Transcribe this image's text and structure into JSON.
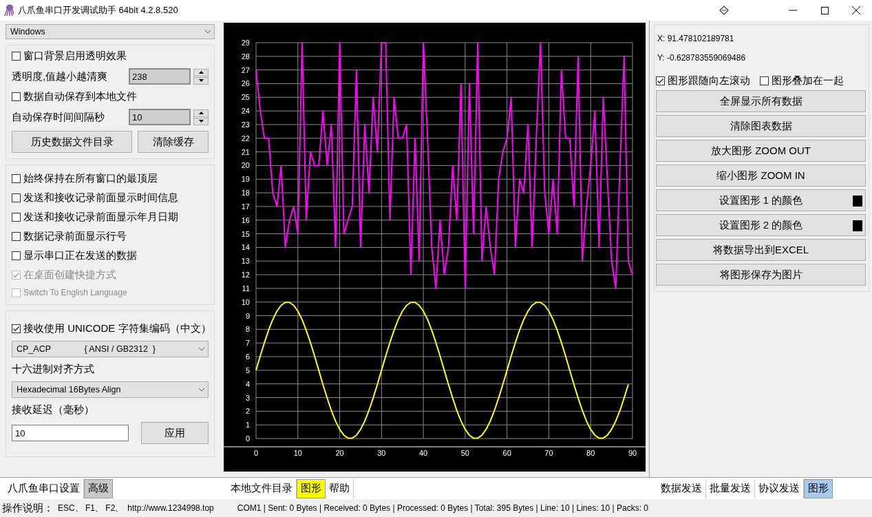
{
  "window": {
    "title": "八爪鱼串口开发调试助手 64bit 4.2.8.520"
  },
  "left_panel": {
    "skin_select": {
      "value": "Windows"
    },
    "group1": {
      "transparent_bg": {
        "label": "窗口背景启用透明效果",
        "checked": false
      },
      "opacity": {
        "label": "透明度,值越小越清爽",
        "value": "238"
      },
      "autosave": {
        "label": "数据自动保存到本地文件",
        "checked": false
      },
      "interval": {
        "label": "自动保存时间间隔秒",
        "value": "10"
      },
      "buttons": [
        "历史数据文件目录",
        "清除缓存"
      ]
    },
    "group2": {
      "options": [
        {
          "label": "始终保持在所有窗口的最顶层",
          "checked": false,
          "disabled": false
        },
        {
          "label": "发送和接收记录前面显示时间信息",
          "checked": false,
          "disabled": false
        },
        {
          "label": "发送和接收记录前面显示年月日期",
          "checked": false,
          "disabled": false
        },
        {
          "label": "数据记录前面显示行号",
          "checked": false,
          "disabled": false
        },
        {
          "label": "显示串口正在发送的数据",
          "checked": false,
          "disabled": false
        },
        {
          "label": "在桌面创建快捷方式",
          "checked": true,
          "disabled": true
        },
        {
          "label": "Switch To English Language",
          "checked": false,
          "disabled": true
        }
      ]
    },
    "group3": {
      "unicode": {
        "label": "接收使用 UNICODE 字符集编码（中文）",
        "checked": true
      },
      "charset_select": {
        "value": "CP_ACP              { ANSI / GB2312  }"
      },
      "align_label": "十六进制对齐方式",
      "align_select": {
        "value": "Hexadecimal 16Bytes Align"
      },
      "delay_label": "接收延迟（毫秒）",
      "delay_input": {
        "value": "10"
      },
      "apply_button": "应用"
    },
    "tabs": [
      {
        "label": "八爪鱼串口设置",
        "selected": false
      },
      {
        "label": "高级",
        "selected": true
      }
    ]
  },
  "chart_panel": {
    "chart_data": {
      "type": "line",
      "grid": true,
      "xlim": [
        0,
        90
      ],
      "ylim": [
        0,
        29
      ],
      "xticks": [
        0,
        10,
        20,
        30,
        40,
        50,
        60,
        70,
        80,
        90
      ],
      "yticks": [
        0,
        1,
        2,
        3,
        4,
        5,
        6,
        7,
        8,
        9,
        10,
        11,
        12,
        13,
        14,
        15,
        16,
        17,
        18,
        19,
        20,
        21,
        22,
        23,
        24,
        25,
        26,
        27,
        28,
        29
      ],
      "x": [
        0,
        1,
        2,
        3,
        4,
        5,
        6,
        7,
        8,
        9,
        10,
        11,
        12,
        13,
        14,
        15,
        16,
        17,
        18,
        19,
        20,
        21,
        22,
        23,
        24,
        25,
        26,
        27,
        28,
        29,
        30,
        31,
        32,
        33,
        34,
        35,
        36,
        37,
        38,
        39,
        40,
        41,
        42,
        43,
        44,
        45,
        46,
        47,
        48,
        49,
        50,
        51,
        52,
        53,
        54,
        55,
        56,
        57,
        58,
        59,
        60,
        61,
        62,
        63,
        64,
        65,
        66,
        67,
        68,
        69,
        70,
        71,
        72,
        73,
        74,
        75,
        76,
        77,
        78,
        79,
        80,
        81,
        82,
        83,
        84,
        85,
        86,
        87,
        88,
        89,
        90
      ],
      "series": [
        {
          "color": "#ff00ff",
          "values": [
            27,
            24,
            22,
            22,
            18,
            17,
            20,
            14,
            16,
            17,
            15,
            29,
            16,
            21,
            20,
            20,
            24,
            20,
            23,
            14,
            29,
            15,
            16,
            17,
            27,
            14,
            23,
            18,
            25,
            21,
            29,
            29,
            16,
            25,
            22,
            22,
            23,
            12,
            22,
            13,
            29,
            22,
            14,
            11,
            16,
            12,
            14,
            20,
            16,
            26,
            11,
            26,
            15,
            29,
            13,
            17,
            14,
            12,
            19,
            21,
            22,
            25,
            14,
            19,
            18,
            23,
            14,
            22,
            29,
            18,
            15,
            19,
            15,
            27,
            22,
            22,
            17,
            28,
            13,
            17,
            20,
            24,
            14,
            25,
            19,
            13,
            11,
            20,
            28,
            13,
            12
          ]
        },
        {
          "color": "#ffff00",
          "values": [
            5,
            6.04,
            7.03,
            7.94,
            8.72,
            9.33,
            9.76,
            9.97,
            9.97,
            9.76,
            9.33,
            8.72,
            7.94,
            7.03,
            6.04,
            5,
            3.96,
            2.97,
            2.06,
            1.28,
            0.67,
            0.24,
            0.03,
            0.03,
            0.24,
            0.67,
            1.28,
            2.06,
            2.97,
            3.96,
            5,
            6.04,
            7.03,
            7.94,
            8.72,
            9.33,
            9.76,
            9.97,
            9.97,
            9.76,
            9.33,
            8.72,
            7.94,
            7.03,
            6.04,
            5,
            3.96,
            2.97,
            2.06,
            1.28,
            0.67,
            0.24,
            0.03,
            0.03,
            0.24,
            0.67,
            1.28,
            2.06,
            2.97,
            3.96,
            5,
            6.04,
            7.03,
            7.94,
            8.72,
            9.33,
            9.76,
            9.97,
            9.97,
            9.76,
            9.33,
            8.72,
            7.94,
            7.03,
            6.04,
            5,
            3.96,
            2.97,
            2.06,
            1.28,
            0.67,
            0.24,
            0.03,
            0.03,
            0.24,
            0.67,
            1.28,
            2.06,
            2.97,
            3.96,
            null
          ]
        }
      ]
    },
    "tabs": [
      {
        "label": "本地文件目录",
        "selected": false
      },
      {
        "label": "图形",
        "selected": true
      },
      {
        "label": "帮助",
        "selected": false
      }
    ]
  },
  "right_panel": {
    "x_readout": "X: 91.478102189781",
    "y_readout": "Y: -0.628783559069486",
    "options": [
      {
        "label": "图形跟随向左滚动",
        "checked": true
      },
      {
        "label": "图形叠加在一起",
        "checked": false
      }
    ],
    "buttons": [
      {
        "kind": "plain",
        "label": "全屏显示所有数据"
      },
      {
        "kind": "plain",
        "label": "清除图表数据"
      },
      {
        "kind": "plain",
        "label": "放大图形 ZOOM OUT"
      },
      {
        "kind": "plain",
        "label": "缩小图形 ZOOM IN"
      },
      {
        "kind": "swatch",
        "label": "设置图形 1 的颜色",
        "color": "#000000"
      },
      {
        "kind": "swatch",
        "label": "设置图形 2 的颜色",
        "color": "#000000"
      },
      {
        "kind": "plain",
        "label": "将数据导出到EXCEL"
      },
      {
        "kind": "plain",
        "label": "将图形保存为图片"
      }
    ],
    "tabs": [
      {
        "label": "数据发送",
        "selected": false
      },
      {
        "label": "批量发送",
        "selected": false
      },
      {
        "label": "协议发送",
        "selected": false
      },
      {
        "label": "图形",
        "selected": true
      }
    ]
  },
  "status_bar": {
    "help_label": "操作说明：",
    "help_keys": "ESC、 F1、 F2、",
    "url": "http://www.1234998.top",
    "info": "COM1 | Sent: 0 Bytes | Received: 0 Bytes | Processed: 0 Bytes | Total: 395 Bytes | Line: 10 | Lines: 10 | Packs: 0"
  }
}
